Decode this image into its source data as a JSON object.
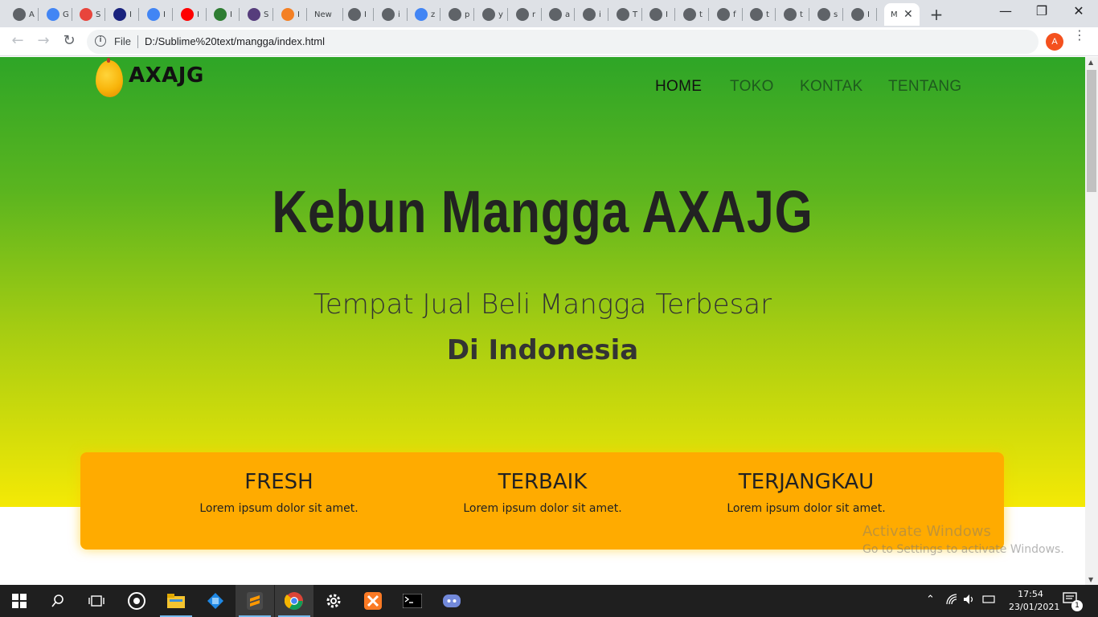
{
  "browser": {
    "tabs": [
      {
        "icon": "globe-icon",
        "title": "A",
        "color": "#5f6368"
      },
      {
        "icon": "google-icon",
        "title": "G",
        "color": "#4285f4"
      },
      {
        "icon": "asterisk-icon",
        "title": "S",
        "color": "#e8453c"
      },
      {
        "icon": "eh-icon",
        "title": "I",
        "color": "#1a237e"
      },
      {
        "icon": "google-icon",
        "title": "I",
        "color": "#4285f4"
      },
      {
        "icon": "youtube-icon",
        "title": "I",
        "color": "#ff0000"
      },
      {
        "icon": "px-icon",
        "title": "I",
        "color": "#2e7d32"
      },
      {
        "icon": "bootstrap-icon",
        "title": "S",
        "color": "#563d7c"
      },
      {
        "icon": "stackoverflow-icon",
        "title": "I",
        "color": "#f48024"
      },
      {
        "icon": "newtab-icon",
        "title": "New",
        "color": "#5f6368"
      },
      {
        "icon": "globe-icon",
        "title": "I",
        "color": "#5f6368"
      },
      {
        "icon": "globe-icon",
        "title": "i",
        "color": "#5f6368"
      },
      {
        "icon": "google-icon",
        "title": "z",
        "color": "#4285f4"
      },
      {
        "icon": "globe-icon",
        "title": "p",
        "color": "#5f6368"
      },
      {
        "icon": "globe-icon",
        "title": "y",
        "color": "#5f6368"
      },
      {
        "icon": "globe-icon",
        "title": "r",
        "color": "#5f6368"
      },
      {
        "icon": "globe-icon",
        "title": "a",
        "color": "#5f6368"
      },
      {
        "icon": "globe-icon",
        "title": "i",
        "color": "#5f6368"
      },
      {
        "icon": "globe-icon",
        "title": "T",
        "color": "#5f6368"
      },
      {
        "icon": "globe-icon",
        "title": "I",
        "color": "#5f6368"
      },
      {
        "icon": "globe-icon",
        "title": "t",
        "color": "#5f6368"
      },
      {
        "icon": "globe-icon",
        "title": "f",
        "color": "#5f6368"
      },
      {
        "icon": "globe-icon",
        "title": "t",
        "color": "#5f6368"
      },
      {
        "icon": "globe-icon",
        "title": "t",
        "color": "#5f6368"
      },
      {
        "icon": "globe-icon",
        "title": "s",
        "color": "#5f6368"
      },
      {
        "icon": "globe-icon",
        "title": "I",
        "color": "#5f6368"
      }
    ],
    "active_tab": {
      "title": "M",
      "close": "✕"
    },
    "new_tab": "+",
    "window_controls": {
      "minimize": "—",
      "restore": "❐",
      "close": "✕"
    },
    "address": {
      "scheme_label": "File",
      "url": "D:/Sublime%20text/mangga/index.html"
    },
    "profile_initial": "A",
    "profile_color": "#f4511e"
  },
  "site": {
    "logo_text": "AXAJG",
    "nav": [
      "HOME",
      "TOKO",
      "KONTAK",
      "TENTANG"
    ],
    "hero_title": "Kebun Mangga AXAJG",
    "hero_subtitle": "Tempat Jual Beli Mangga Terbesar",
    "hero_subtitle_bold": "Di Indonesia",
    "features": [
      {
        "title": "FRESH",
        "text": "Lorem ipsum dolor sit amet."
      },
      {
        "title": "TERBAIK",
        "text": "Lorem ipsum dolor sit amet."
      },
      {
        "title": "TERJANGKAU",
        "text": "Lorem ipsum dolor sit amet."
      }
    ],
    "colors": {
      "hero_top": "#2ea527",
      "hero_bottom": "#f4e905",
      "feature_box": "#ffab00"
    }
  },
  "os": {
    "watermark_title": "Activate Windows",
    "watermark_text": "Go to Settings to activate Windows.",
    "clock_time": "17:54",
    "clock_date": "23/01/2021",
    "notification_count": "1",
    "taskbar_apps": [
      "start-icon",
      "search-icon",
      "task-view-icon",
      "obs-icon",
      "file-explorer-icon",
      "app-icon",
      "sublime-text-icon",
      "chrome-icon",
      "settings-icon",
      "xampp-icon",
      "terminal-icon",
      "discord-icon"
    ]
  }
}
